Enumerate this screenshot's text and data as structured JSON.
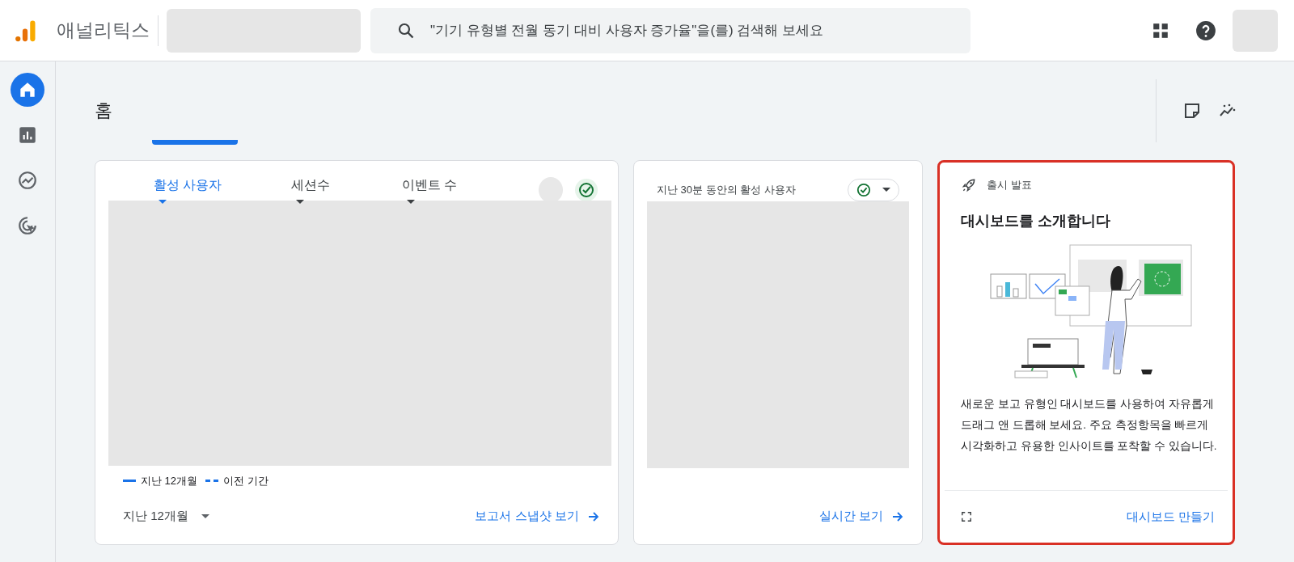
{
  "header": {
    "app_name": "애널리틱스",
    "search": {
      "placeholder": "\"기기 유형별 전월 동기 대비 사용자 증가율\"을(를) 검색해 보세요"
    }
  },
  "sidebar": {
    "items": [
      {
        "kind": "home",
        "selected": true
      },
      {
        "kind": "reports",
        "selected": false
      },
      {
        "kind": "explore",
        "selected": false
      },
      {
        "kind": "advertising",
        "selected": false
      }
    ]
  },
  "page": {
    "title": "홈"
  },
  "overview_card": {
    "tabs": [
      {
        "label": "활성 사용자",
        "selected": true
      },
      {
        "label": "세션수",
        "selected": false
      },
      {
        "label": "이벤트 수",
        "selected": false
      }
    ],
    "legend": [
      {
        "label": "지난 12개월",
        "kind": "solid"
      },
      {
        "label": "이전 기간",
        "kind": "dashed"
      }
    ],
    "period": "지난 12개월",
    "link": "보고서 스냅샷 보기"
  },
  "realtime_card": {
    "title": "지난 30분 동안의 활성 사용자",
    "link": "실시간 보기"
  },
  "announcement_card": {
    "highlighted": true,
    "eyebrow": "출시 발표",
    "title": "대시보드를 소개합니다",
    "body": "새로운 보고 유형인 대시보드를 사용하여 자유롭게 드래그 앤 드롭해 보세요. 주요 측정항목을 빠르게 시각화하고 유용한 인사이트를 포착할 수 있습니다.",
    "action": "대시보드 만들기"
  }
}
